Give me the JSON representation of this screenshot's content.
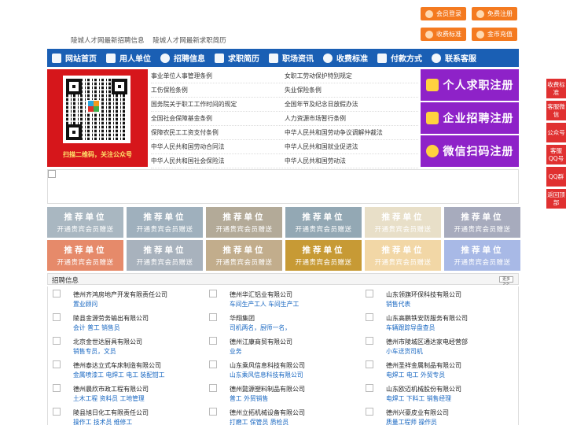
{
  "top": {
    "links": [
      "陵城人才网最新招聘信息",
      "陵城人才网最新求职简历"
    ],
    "buttons": [
      "会员登录",
      "免费注册",
      "收费标准",
      "金币充值"
    ]
  },
  "nav": [
    "网站首页",
    "用人单位",
    "招聘信息",
    "求职简历",
    "职场资讯",
    "收费标准",
    "付款方式",
    "联系客服"
  ],
  "qr": {
    "caption": "扫描二维码，关注公众号"
  },
  "links": [
    [
      "事业单位人事管理条例",
      "女职工劳动保护特别规定"
    ],
    [
      "工伤保险条例",
      "失业保险条例"
    ],
    [
      "国务院关于职工工作时间的规定",
      "全国年节及纪念日放假办法"
    ],
    [
      "全国社会保障基金条例",
      "人力资源市场暂行条例"
    ],
    [
      "保障农民工工资支付条例",
      "中华人民共和国劳动争议调解仲裁法"
    ],
    [
      "中华人民共和国劳动合同法",
      "中华人民共和国就业促进法"
    ],
    [
      "中华人民共和国社会保险法",
      "中华人民共和国劳动法"
    ]
  ],
  "register": [
    "个人求职注册",
    "企业招聘注册",
    "微信扫码注册"
  ],
  "recommend": {
    "title": "推荐单位",
    "subtitle": "开通贵宾会员赠送",
    "colors": [
      "#a9b7c1",
      "#9fb0bd",
      "#b3aa98",
      "#93a8b4",
      "#e8dfc8",
      "#a7abbd",
      "#e68a6a",
      "#a8b2bd",
      "#c2ad8c",
      "#c79a35",
      "#f2d7a6",
      "#a8b9e6"
    ]
  },
  "jobs": {
    "title": "招聘信息",
    "more": "更多>>",
    "items": [
      {
        "company": "德州齐鸿房地产开发有限责任公司",
        "positions": "置业顾问"
      },
      {
        "company": "德州华汇铝业有限公司",
        "positions": "车间生产工人 车间生产工"
      },
      {
        "company": "山东领旗环保科技有限公司",
        "positions": "销售代表"
      },
      {
        "company": "陵县金源劳务输出有限公司",
        "positions": "会计 普工 销售员"
      },
      {
        "company": "华翔集团",
        "positions": "司机两名，厨师一名，"
      },
      {
        "company": "山东高鹏铁安防服务有限公司",
        "positions": "车辆跟踪导盘查员"
      },
      {
        "company": "北京金世达厨具有限公司",
        "positions": "销售专员，文员"
      },
      {
        "company": "德州江康商贸有限公司",
        "positions": "业务"
      },
      {
        "company": "德州市陵城区通达家电经营部",
        "positions": "小车送货司机"
      },
      {
        "company": "德州泰达立式车床制造有限公司",
        "positions": "金属喷漆工 电焊工 电工 装配钳工"
      },
      {
        "company": "山东乘风信息科技有限公司",
        "positions": "山东乘风信息科技有限公司"
      },
      {
        "company": "德州圣祥金属制品有限公司",
        "positions": "电焊工 电工 外贸专员"
      },
      {
        "company": "德州晨欣市政工程有限公司",
        "positions": "土木工程 资料员 工地管理"
      },
      {
        "company": "德州懿源塑料制品有限公司",
        "positions": "普工 外贸销售"
      },
      {
        "company": "山东欧迈机械股份有限公司",
        "positions": "电焊工 下料工 销售经理"
      },
      {
        "company": "陵县旭日化工有限责任公司",
        "positions": "操作工 技术员 维修工"
      },
      {
        "company": "德州立拓机械设备有限公司",
        "positions": "打磨工 保管员 质检员"
      },
      {
        "company": "德州兴豪皮业有限公司",
        "positions": "质量工程师 操作员"
      }
    ]
  },
  "sidebar": [
    "收费标准",
    "客服微信",
    "公众号",
    "客服QQ号",
    "QQ群",
    "返回顶部"
  ]
}
